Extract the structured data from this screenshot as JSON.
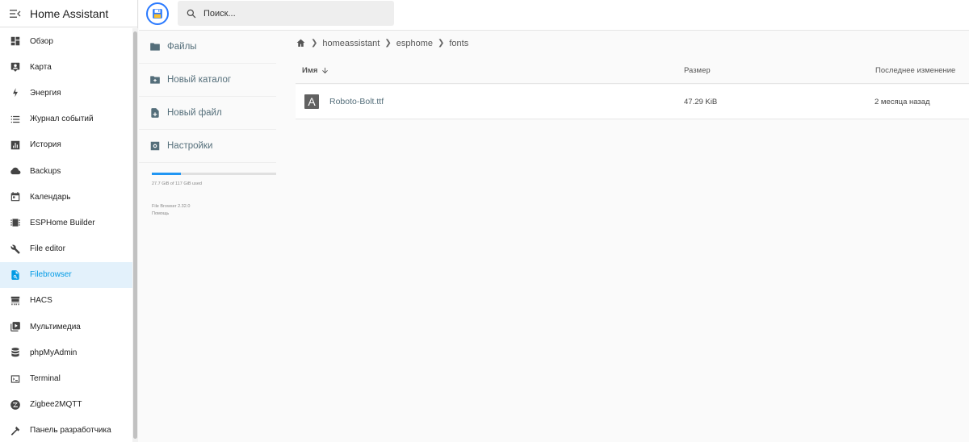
{
  "app": {
    "title": "Home Assistant"
  },
  "sidebar": {
    "items": [
      {
        "label": "Обзор",
        "icon": "dashboard-icon"
      },
      {
        "label": "Карта",
        "icon": "map-icon"
      },
      {
        "label": "Энергия",
        "icon": "energy-icon"
      },
      {
        "label": "Журнал событий",
        "icon": "logbook-icon"
      },
      {
        "label": "История",
        "icon": "history-icon"
      },
      {
        "label": "Backups",
        "icon": "cloud-icon"
      },
      {
        "label": "Календарь",
        "icon": "calendar-icon"
      },
      {
        "label": "ESPHome Builder",
        "icon": "esphome-icon"
      },
      {
        "label": "File editor",
        "icon": "wrench-icon"
      },
      {
        "label": "Filebrowser",
        "icon": "filebrowser-icon",
        "active": true
      },
      {
        "label": "HACS",
        "icon": "hacs-icon"
      },
      {
        "label": "Мультимедиа",
        "icon": "media-icon"
      },
      {
        "label": "phpMyAdmin",
        "icon": "database-icon"
      },
      {
        "label": "Terminal",
        "icon": "terminal-icon"
      },
      {
        "label": "Zigbee2MQTT",
        "icon": "zigbee-icon"
      },
      {
        "label": "Панель разработчика",
        "icon": "hammer-icon"
      }
    ]
  },
  "search": {
    "placeholder": "Поиск..."
  },
  "fb_nav": {
    "files": "Файлы",
    "new_folder": "Новый каталог",
    "new_file": "Новый файл",
    "settings": "Настройки"
  },
  "storage": {
    "text": "27.7 GiB of 117 GiB used",
    "used_fraction": 0.237
  },
  "footer": {
    "version": "File Browser 2.32.0",
    "help": "Помощь"
  },
  "breadcrumb": [
    "homeassistant",
    "esphome",
    "fonts"
  ],
  "table": {
    "col_name": "Имя",
    "col_size": "Размер",
    "col_modified": "Последнее изменение",
    "rows": [
      {
        "icon_glyph": "A",
        "name": "Roboto-Bolt.ttf",
        "size": "47.29 KiB",
        "modified": "2 месяца назад"
      }
    ]
  },
  "colors": {
    "accent": "#039be5",
    "active_bg": "#e3f1fb",
    "progress": "#2196f3"
  }
}
